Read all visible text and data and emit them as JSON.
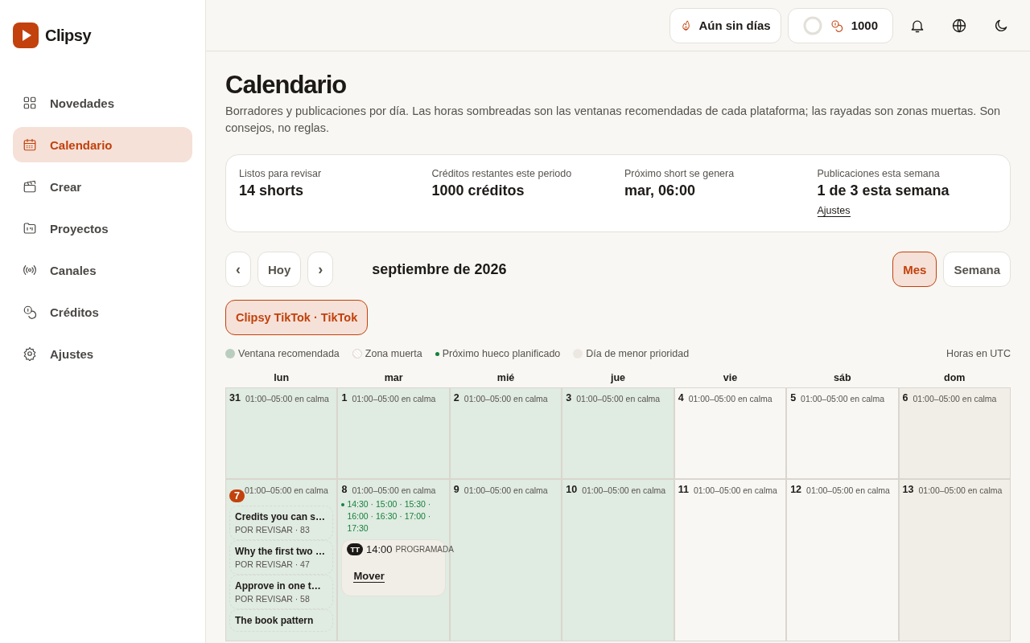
{
  "brand": {
    "name": "Clipsy"
  },
  "sidebar": {
    "items": [
      {
        "label": "Novedades",
        "selected": false
      },
      {
        "label": "Calendario",
        "selected": true
      },
      {
        "label": "Crear",
        "selected": false
      },
      {
        "label": "Proyectos",
        "selected": false
      },
      {
        "label": "Canales",
        "selected": false
      },
      {
        "label": "Créditos",
        "selected": false
      },
      {
        "label": "Ajustes",
        "selected": false
      }
    ]
  },
  "topbar": {
    "streak": "Aún sin días",
    "credits": {
      "amount": "1000"
    }
  },
  "page": {
    "title": "Calendario",
    "subtitle": "Borradores y publicaciones por día. Las horas sombreadas son las ventanas recomendadas de cada plataforma; las rayadas son zonas muertas. Son consejos, no reglas."
  },
  "stats": [
    {
      "label": "Listos para revisar",
      "value": "14 shorts"
    },
    {
      "label": "Créditos restantes este periodo",
      "value": "1000 créditos"
    },
    {
      "label": "Próximo short se genera",
      "value": "mar, 06:00"
    },
    {
      "label": "Publicaciones esta semana",
      "value": "1 de 3 esta semana",
      "link": "Ajustes"
    }
  ],
  "nav": {
    "prev": "‹",
    "today": "Hoy",
    "next": "›",
    "month": "septiembre de 2026",
    "views": [
      {
        "label": "Mes",
        "selected": true
      },
      {
        "label": "Semana",
        "selected": false
      }
    ]
  },
  "filters": [
    {
      "label": "Clipsy TikTok · TikTok",
      "selected": true
    }
  ],
  "legend": [
    {
      "kind": "recommended",
      "label": "Ventana recomendada"
    },
    {
      "kind": "dead",
      "label": "Zona muerta"
    },
    {
      "kind": "next",
      "label": "Próximo hueco planificado"
    },
    {
      "kind": "low",
      "label": "Día de menor prioridad"
    }
  ],
  "timezone": "Horas en UTC",
  "calendar": {
    "weekdays": [
      "lun",
      "mar",
      "mié",
      "jue",
      "vie",
      "sáb",
      "dom"
    ],
    "weeks": [
      [
        {
          "day": "31",
          "note": "01:00–05:00 en calma",
          "kind": "recommended",
          "today": false
        },
        {
          "day": "1",
          "note": "01:00–05:00 en calma",
          "kind": "recommended",
          "today": false
        },
        {
          "day": "2",
          "note": "01:00–05:00 en calma",
          "kind": "recommended",
          "today": false
        },
        {
          "day": "3",
          "note": "01:00–05:00 en calma",
          "kind": "recommended",
          "today": false
        },
        {
          "day": "4",
          "note": "01:00–05:00 en calma",
          "kind": "normal",
          "today": false
        },
        {
          "day": "5",
          "note": "01:00–05:00 en calma",
          "kind": "normal",
          "today": false
        },
        {
          "day": "6",
          "note": "01:00–05:00 en calma",
          "kind": "low",
          "today": false
        }
      ],
      [
        {
          "day": "7",
          "note": "01:00–05:00 en calma",
          "kind": "recommended",
          "today": true,
          "drafts": [
            {
              "title": "Credits you can s…",
              "meta": "POR REVISAR · 83"
            },
            {
              "title": "Why the first two …",
              "meta": "POR REVISAR · 47"
            },
            {
              "title": "Approve in one t…",
              "meta": "POR REVISAR · 58"
            },
            {
              "title": "The book pattern"
            }
          ]
        },
        {
          "day": "8",
          "note": "01:00–05:00 en calma",
          "kind": "recommended",
          "today": false,
          "slots": "14:30 · 15:00 · 15:30 · 16:00 · 16:30 · 17:00 · 17:30",
          "posts": [
            {
              "platform": "TT",
              "time": "14:00",
              "status": "PROGRAMADA",
              "action": "Mover"
            }
          ]
        },
        {
          "day": "9",
          "note": "01:00–05:00 en calma",
          "kind": "recommended",
          "today": false
        },
        {
          "day": "10",
          "note": "01:00–05:00 en calma",
          "kind": "recommended",
          "today": false
        },
        {
          "day": "11",
          "note": "01:00–05:00 en calma",
          "kind": "normal",
          "today": false
        },
        {
          "day": "12",
          "note": "01:00–05:00 en calma",
          "kind": "normal",
          "today": false
        },
        {
          "day": "13",
          "note": "01:00–05:00 en calma",
          "kind": "low",
          "today": false
        }
      ]
    ]
  }
}
